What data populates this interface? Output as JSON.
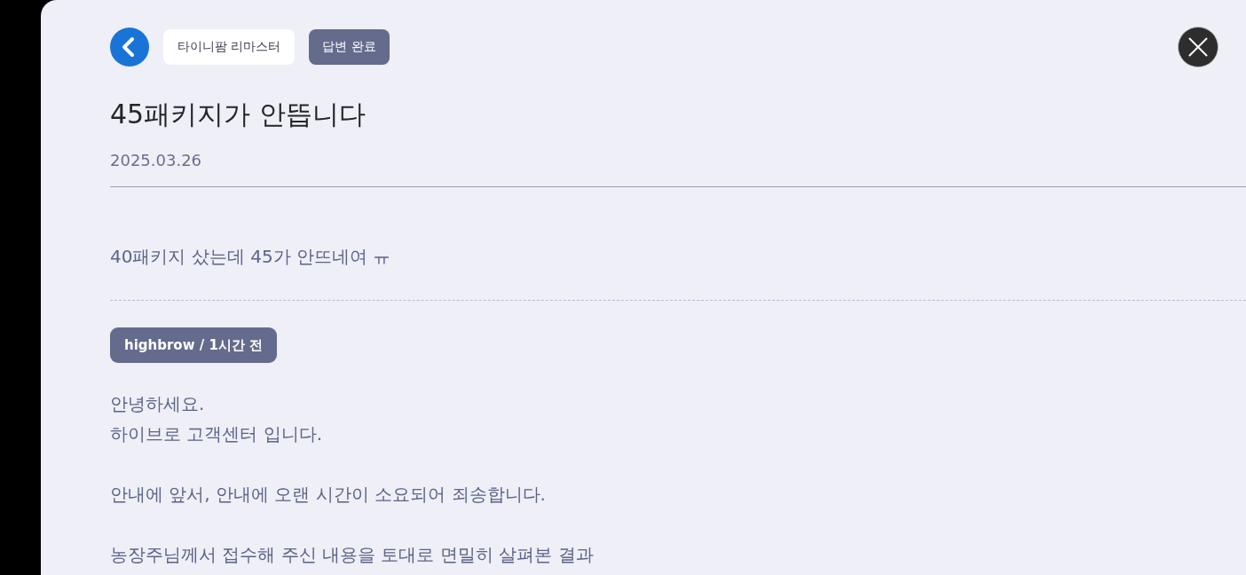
{
  "header": {
    "game_chip": "타이니팜 리마스터",
    "status_badge": "답변 완료"
  },
  "question": {
    "title": "45패키지가 안뜹니다",
    "date": "2025.03.26",
    "body": "40패키지 샀는데 45가 안뜨네여 ㅠ"
  },
  "answer": {
    "author_tag": "highbrow / 1시간 전",
    "paragraphs": [
      [
        "안녕하세요.",
        "하이브로 고객센터 입니다."
      ],
      [
        "안내에 앞서, 안내에 오랜 시간이 소요되어 죄송합니다."
      ],
      [
        "농장주님께서 접수해 주신 내용을 토대로 면밀히 살펴본 결과"
      ]
    ]
  }
}
